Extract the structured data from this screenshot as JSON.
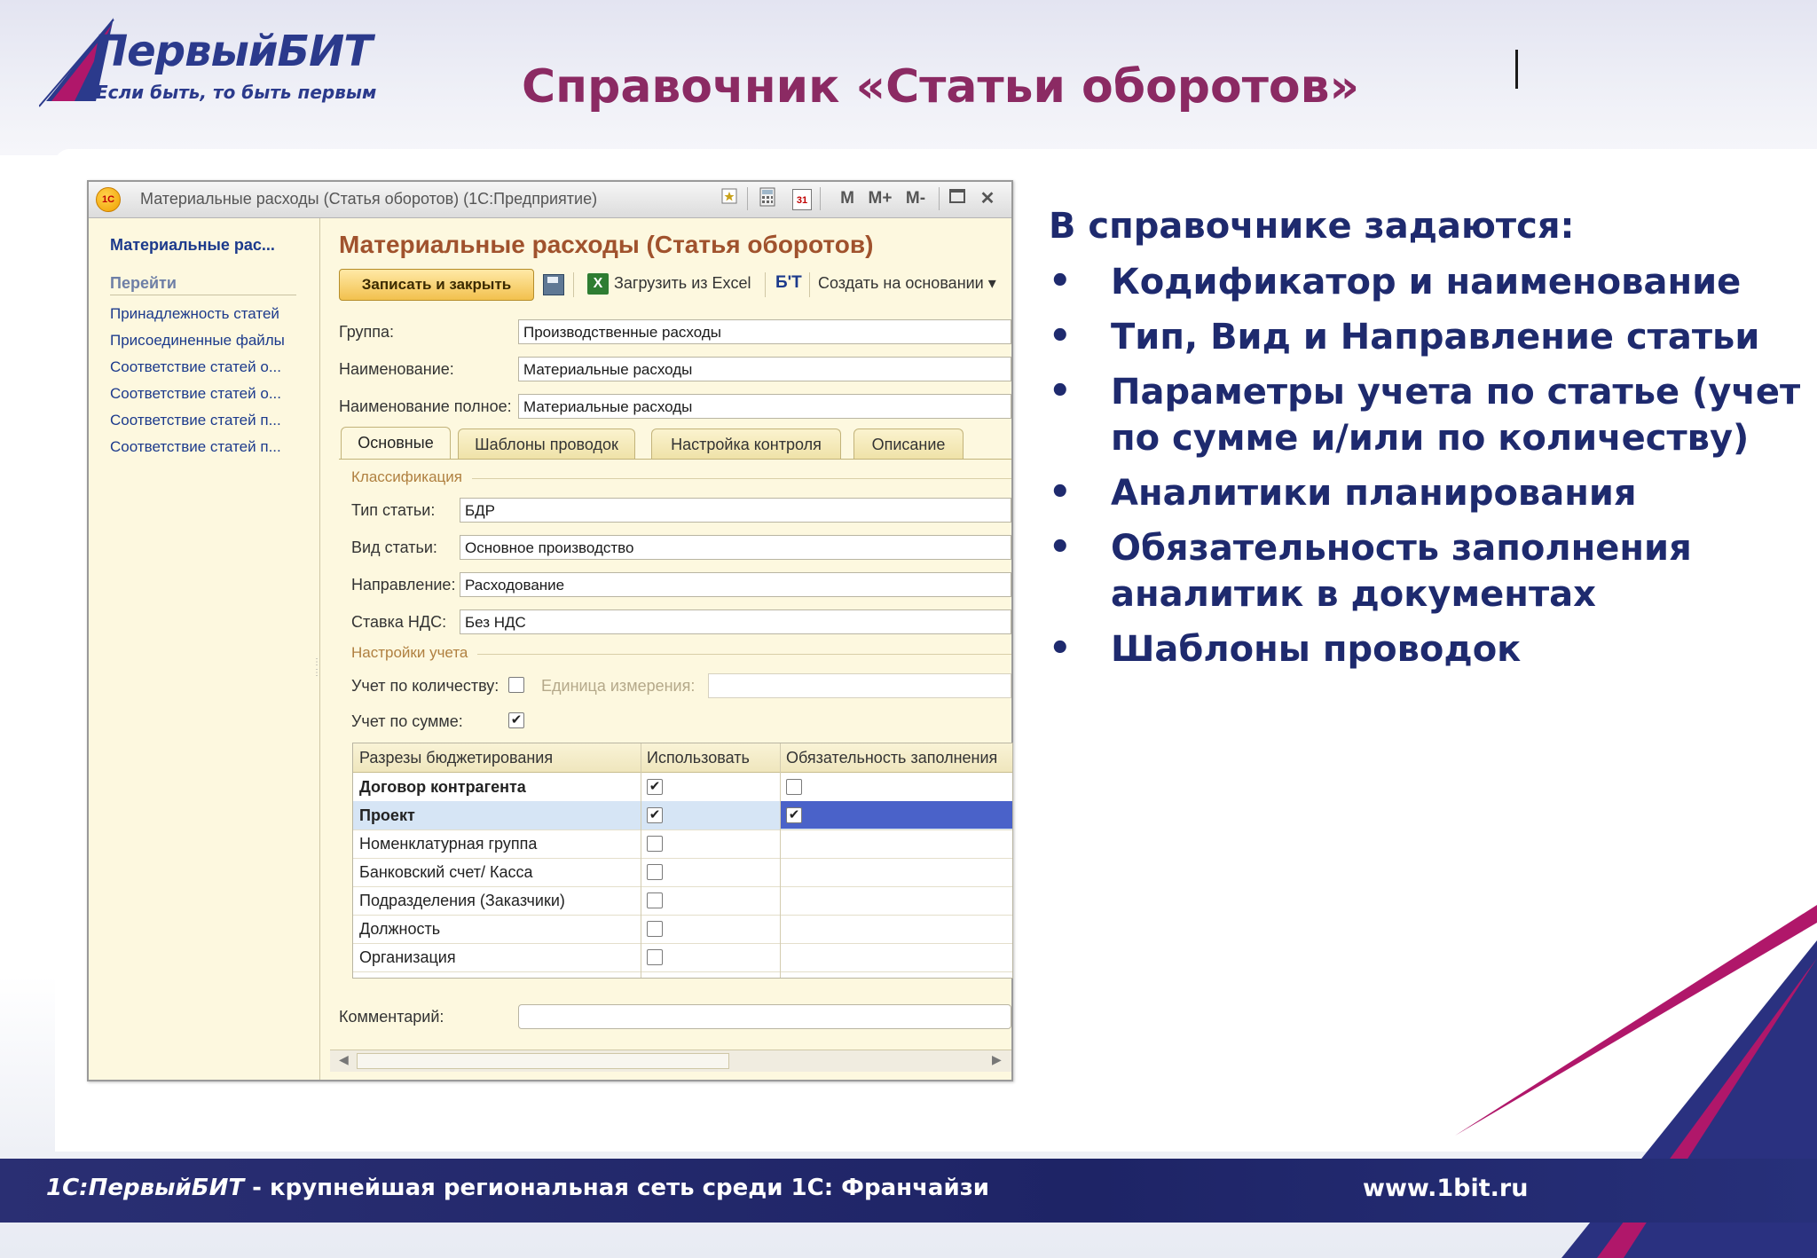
{
  "header": {
    "logo_name": "ПервыйБИТ",
    "logo_tagline": "Если быть, то быть первым",
    "slide_title": "Справочник «Статьи оборотов»"
  },
  "window": {
    "app_icon": "1С",
    "title": "Материальные расходы (Статья оборотов)  (1С:Предприятие)",
    "toolbar_icons": [
      "favorite-icon",
      "calculator-icon",
      "calendar-icon",
      "m-icon",
      "m-plus-icon",
      "m-minus-icon",
      "maximize-icon",
      "close-icon"
    ],
    "toolbar_labels": {
      "calendar": "31",
      "m": "M",
      "m_plus": "M+",
      "m_minus": "M-",
      "close": "✕"
    }
  },
  "left_panel": {
    "title": "Материальные рас...",
    "goto_label": "Перейти",
    "links": [
      "Принадлежность статей",
      "Присоединенные файлы",
      "Соответствие статей о...",
      "Соответствие статей о...",
      "Соответствие статей п...",
      "Соответствие статей п..."
    ]
  },
  "form": {
    "title": "Материальные расходы (Статья оборотов)",
    "save_close_label": "Записать и закрыть",
    "excel_icon": "X",
    "excel_label": "Загрузить из Excel",
    "struct_icon": "Б'Т",
    "create_based_label": "Создать на основании ▾",
    "group_label": "Группа:",
    "group_value": "Производственные расходы",
    "name_label": "Наименование:",
    "name_value": "Материальные расходы",
    "fullname_label": "Наименование полное:",
    "fullname_value": "Материальные расходы",
    "tabs": [
      "Основные",
      "Шаблоны проводок",
      "Настройка контроля",
      "Описание"
    ],
    "classification_label": "Классификация",
    "type_label": "Тип статьи:",
    "type_value": "БДР",
    "kind_label": "Вид статьи:",
    "kind_value": "Основное производство",
    "direction_label": "Направление:",
    "direction_value": "Расходование",
    "vat_label": "Ставка НДС:",
    "vat_value": "Без НДС",
    "accounting_label": "Настройки учета",
    "by_quantity_label": "Учет по количеству:",
    "by_quantity_checked": "",
    "unit_label": "Единица измерения:",
    "by_sum_label": "Учет по сумме:",
    "by_sum_checked": "✔",
    "grid": {
      "columns": [
        "Разрезы бюджетирования",
        "Использовать",
        "Обязательность заполнения"
      ],
      "rows": [
        {
          "name": "Договор контрагента",
          "use": "✔",
          "required": ""
        },
        {
          "name": "Проект",
          "use": "✔",
          "required": "✔"
        },
        {
          "name": "Номенклатурная группа",
          "use": "",
          "required": null
        },
        {
          "name": "Банковский счет/ Касса",
          "use": "",
          "required": null
        },
        {
          "name": "Подразделения (Заказчики)",
          "use": "",
          "required": null
        },
        {
          "name": "Должность",
          "use": "",
          "required": null
        },
        {
          "name": "Организация",
          "use": "",
          "required": null
        }
      ]
    },
    "comment_label": "Комментарий:",
    "comment_value": ""
  },
  "right_panel": {
    "heading": "В справочнике задаются:",
    "bullet": "•",
    "items": [
      [
        "Кодификатор и наименование"
      ],
      [
        "Тип, Вид и Направление статьи"
      ],
      [
        "Параметры учета по статье (учет",
        "по сумме и/или по количеству)"
      ],
      [
        "Аналитики планирования"
      ],
      [
        "Обязательность заполнения",
        "аналитик в документах"
      ],
      [
        "Шаблоны проводок"
      ]
    ]
  },
  "footer": {
    "left_brand": "1С:ПервыйБИТ",
    "left_text": " - крупнейшая региональная сеть среди 1С: Франчайзи",
    "url": "www.1bit.ru"
  },
  "colors": {
    "title": "#8b2a63",
    "brand_blue": "#1e2a6e",
    "footer_bg": "#1e2466",
    "accent_magenta": "#b0176a",
    "selection_blue": "#4a62c9"
  }
}
